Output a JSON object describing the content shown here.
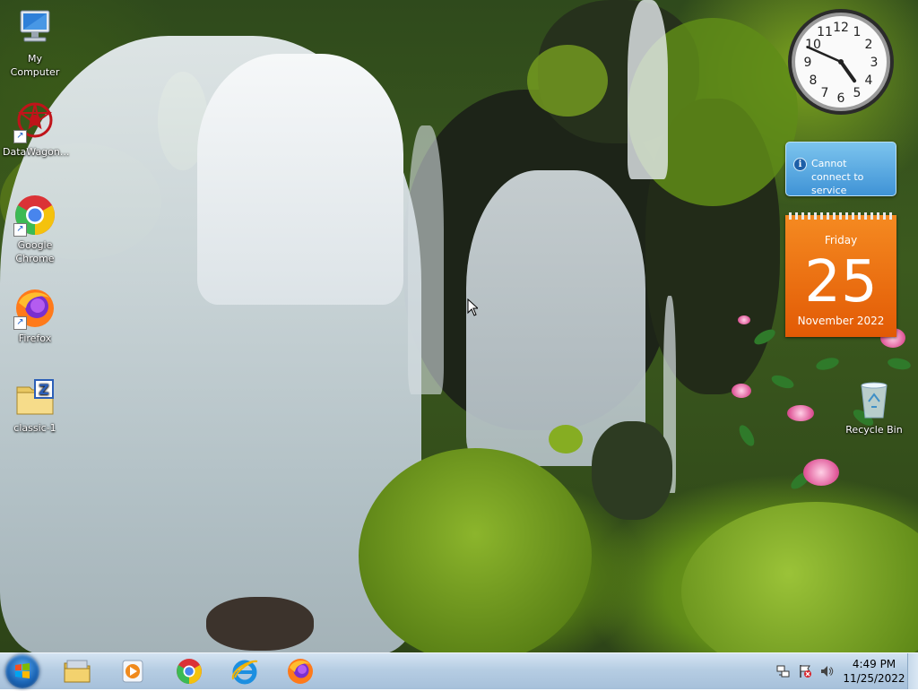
{
  "desktop": {
    "icons": [
      {
        "label": "My Computer",
        "icon": "computer-icon"
      },
      {
        "label": "DataWagon...",
        "icon": "datawagon-icon"
      },
      {
        "label": "Google Chrome",
        "icon": "chrome-icon"
      },
      {
        "label": "Firefox",
        "icon": "firefox-icon"
      },
      {
        "label": "classic-1",
        "icon": "zip-folder-icon"
      },
      {
        "label": "Recycle Bin",
        "icon": "recycle-bin-icon"
      }
    ]
  },
  "gadgets": {
    "clock": {
      "hour": 4,
      "minute": 49
    },
    "service": {
      "message": "Cannot connect to service"
    },
    "calendar": {
      "day_of_week": "Friday",
      "day": "25",
      "month_year": "November 2022"
    }
  },
  "taskbar": {
    "pinned": [
      {
        "name": "windows-explorer",
        "icon": "folder-icon"
      },
      {
        "name": "windows-media-player",
        "icon": "media-player-icon"
      },
      {
        "name": "google-chrome",
        "icon": "chrome-icon"
      },
      {
        "name": "internet-explorer",
        "icon": "ie-icon"
      },
      {
        "name": "firefox",
        "icon": "firefox-icon"
      }
    ],
    "tray": {
      "icons": [
        "network-icon",
        "action-center-flag-icon",
        "volume-icon"
      ],
      "time": "4:49 PM",
      "date": "11/25/2022"
    }
  },
  "colors": {
    "calendar_orange": "#f07a14",
    "service_blue": "#4f9fde",
    "taskbar_blue": "#b6cde3"
  }
}
